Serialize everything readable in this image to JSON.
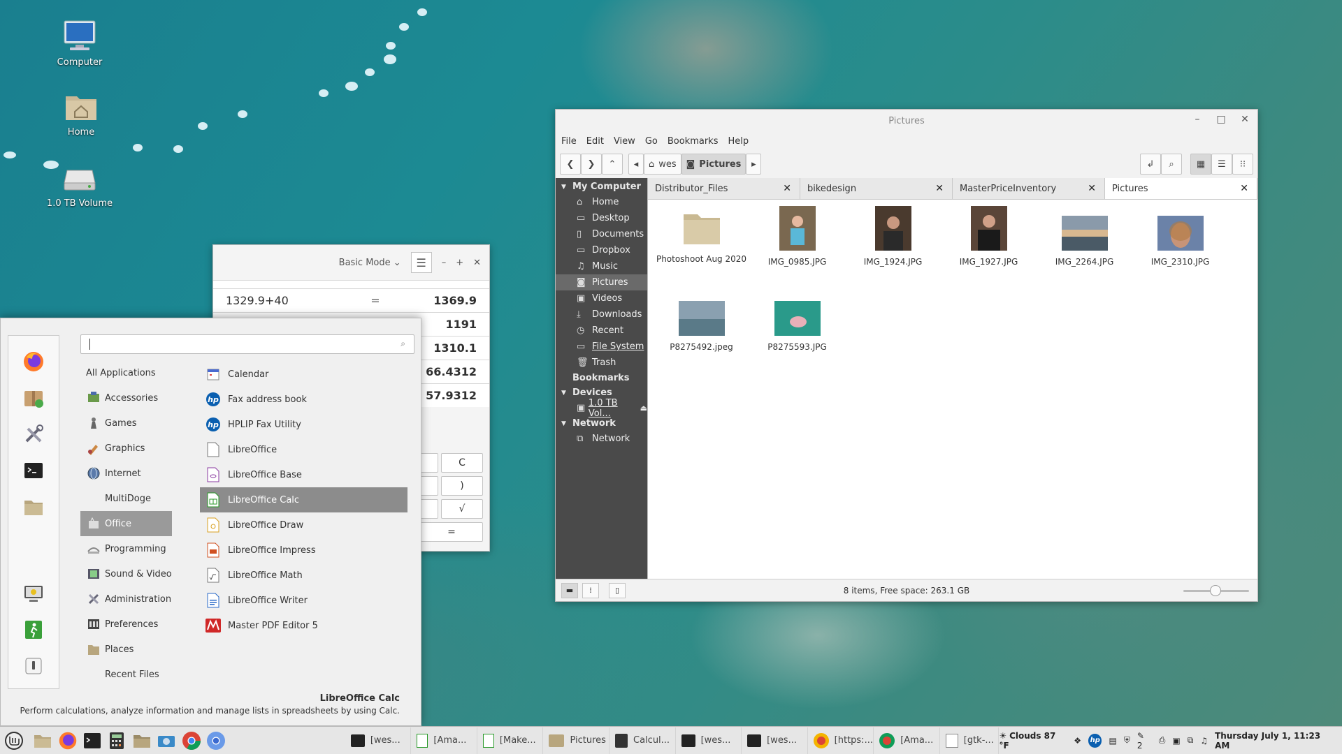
{
  "desktop": {
    "icons": [
      {
        "label": "Computer",
        "icon": "monitor-icon"
      },
      {
        "label": "Home",
        "icon": "home-folder-icon"
      },
      {
        "label": "1.0 TB Volume",
        "icon": "drive-icon"
      }
    ]
  },
  "file_manager": {
    "title": "Pictures",
    "menu": [
      "File",
      "Edit",
      "View",
      "Go",
      "Bookmarks",
      "Help"
    ],
    "path": [
      "wes",
      "Pictures"
    ],
    "sidebar": {
      "my_computer": "My Computer",
      "items": [
        "Home",
        "Desktop",
        "Documents",
        "Dropbox",
        "Music",
        "Pictures",
        "Videos",
        "Downloads",
        "Recent",
        "File System",
        "Trash"
      ],
      "bookmarks": "Bookmarks",
      "devices": "Devices",
      "device_items": [
        "1.0 TB Vol..."
      ],
      "network": "Network",
      "network_items": [
        "Network"
      ]
    },
    "tabs": [
      "Distributor_Files",
      "bikedesign",
      "MasterPriceInventory",
      "Pictures"
    ],
    "files": [
      {
        "name": "Photoshoot Aug 2020",
        "type": "folder"
      },
      {
        "name": "IMG_0985.JPG",
        "type": "image",
        "color": "#7a6850"
      },
      {
        "name": "IMG_1924.JPG",
        "type": "image",
        "color": "#4a3a2e"
      },
      {
        "name": "IMG_1927.JPG",
        "type": "image",
        "color": "#5a4538"
      },
      {
        "name": "IMG_2264.JPG",
        "type": "image",
        "color": "#6c7a8a"
      },
      {
        "name": "IMG_2310.JPG",
        "type": "image",
        "color": "#6b82a8"
      },
      {
        "name": "P8275492.jpeg",
        "type": "image",
        "color": "#6f8a99"
      },
      {
        "name": "P8275593.JPG",
        "type": "image",
        "color": "#2a9a8a"
      }
    ],
    "status": "8 items, Free space: 263.1 GB"
  },
  "calculator": {
    "mode": "Basic Mode",
    "history": [
      {
        "expr": "1329.9+40",
        "eq": "=",
        "result": "1369.9"
      },
      {
        "expr": "",
        "eq": "",
        "result": "1191"
      },
      {
        "expr": "",
        "eq": "",
        "result": "1310.1"
      },
      {
        "expr": "",
        "eq": "",
        "result": "66.4312"
      },
      {
        "expr": "",
        "eq": "",
        "result": "57.9312"
      }
    ],
    "buttons": [
      "C",
      ")",
      "√",
      "="
    ]
  },
  "app_menu": {
    "search_placeholder": "",
    "categories": [
      "All Applications",
      "Accessories",
      "Games",
      "Graphics",
      "Internet",
      "MultiDoge",
      "Office",
      "Programming",
      "Sound & Video",
      "Administration",
      "Preferences",
      "Places",
      "Recent Files"
    ],
    "apps": [
      "Calendar",
      "Fax address book",
      "HPLIP Fax Utility",
      "LibreOffice",
      "LibreOffice Base",
      "LibreOffice Calc",
      "LibreOffice Draw",
      "LibreOffice Impress",
      "LibreOffice Math",
      "LibreOffice Writer",
      "Master PDF Editor 5"
    ],
    "selected_title": "LibreOffice Calc",
    "selected_description": "Perform calculations, analyze information and manage lists in spreadsheets by using Calc."
  },
  "taskbar": {
    "tasks": [
      "[wes...",
      "[Ama...",
      "[Make...",
      "Pictures",
      "Calcul...",
      "[wes...",
      "[wes...",
      "[https:...",
      "[Ama...",
      "[gtk-..."
    ],
    "weather": "Clouds 87 °F",
    "notify_count": "2",
    "clock": "Thursday July  1, 11:23 AM"
  }
}
